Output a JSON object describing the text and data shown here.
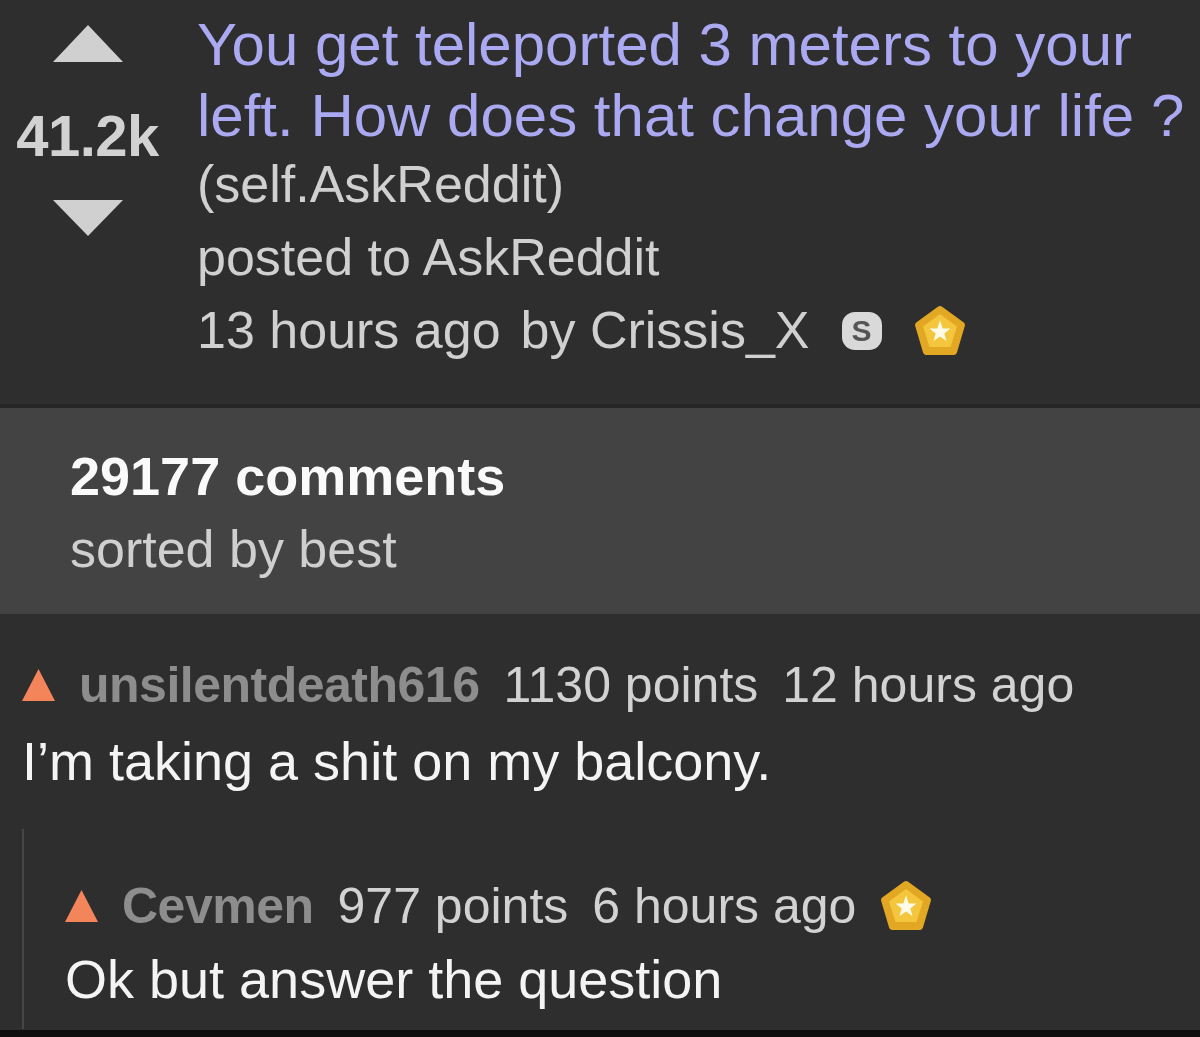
{
  "post": {
    "score": "41.2k",
    "title": "You get teleported 3 meters to your left. How does that change your life ?",
    "domain": "(self.AskReddit)",
    "subreddit_line": "posted to AskReddit",
    "time": "13 hours ago",
    "byline": "by Crissis_X",
    "badges": [
      {
        "kind": "letter",
        "text": "S"
      },
      {
        "kind": "award"
      }
    ]
  },
  "comments_header": {
    "count": "29177 comments",
    "sort": "sorted by best"
  },
  "comments": [
    {
      "author": "unsilentdeath616",
      "points": "1130 points",
      "time": "12 hours ago",
      "body": "I’m taking a shit on my balcony.",
      "children": [
        {
          "author": "Cevmen",
          "points": "977 points",
          "time": "6 hours ago",
          "badges": [
            {
              "kind": "award"
            }
          ],
          "body": "Ok but answer the question"
        }
      ]
    }
  ]
}
